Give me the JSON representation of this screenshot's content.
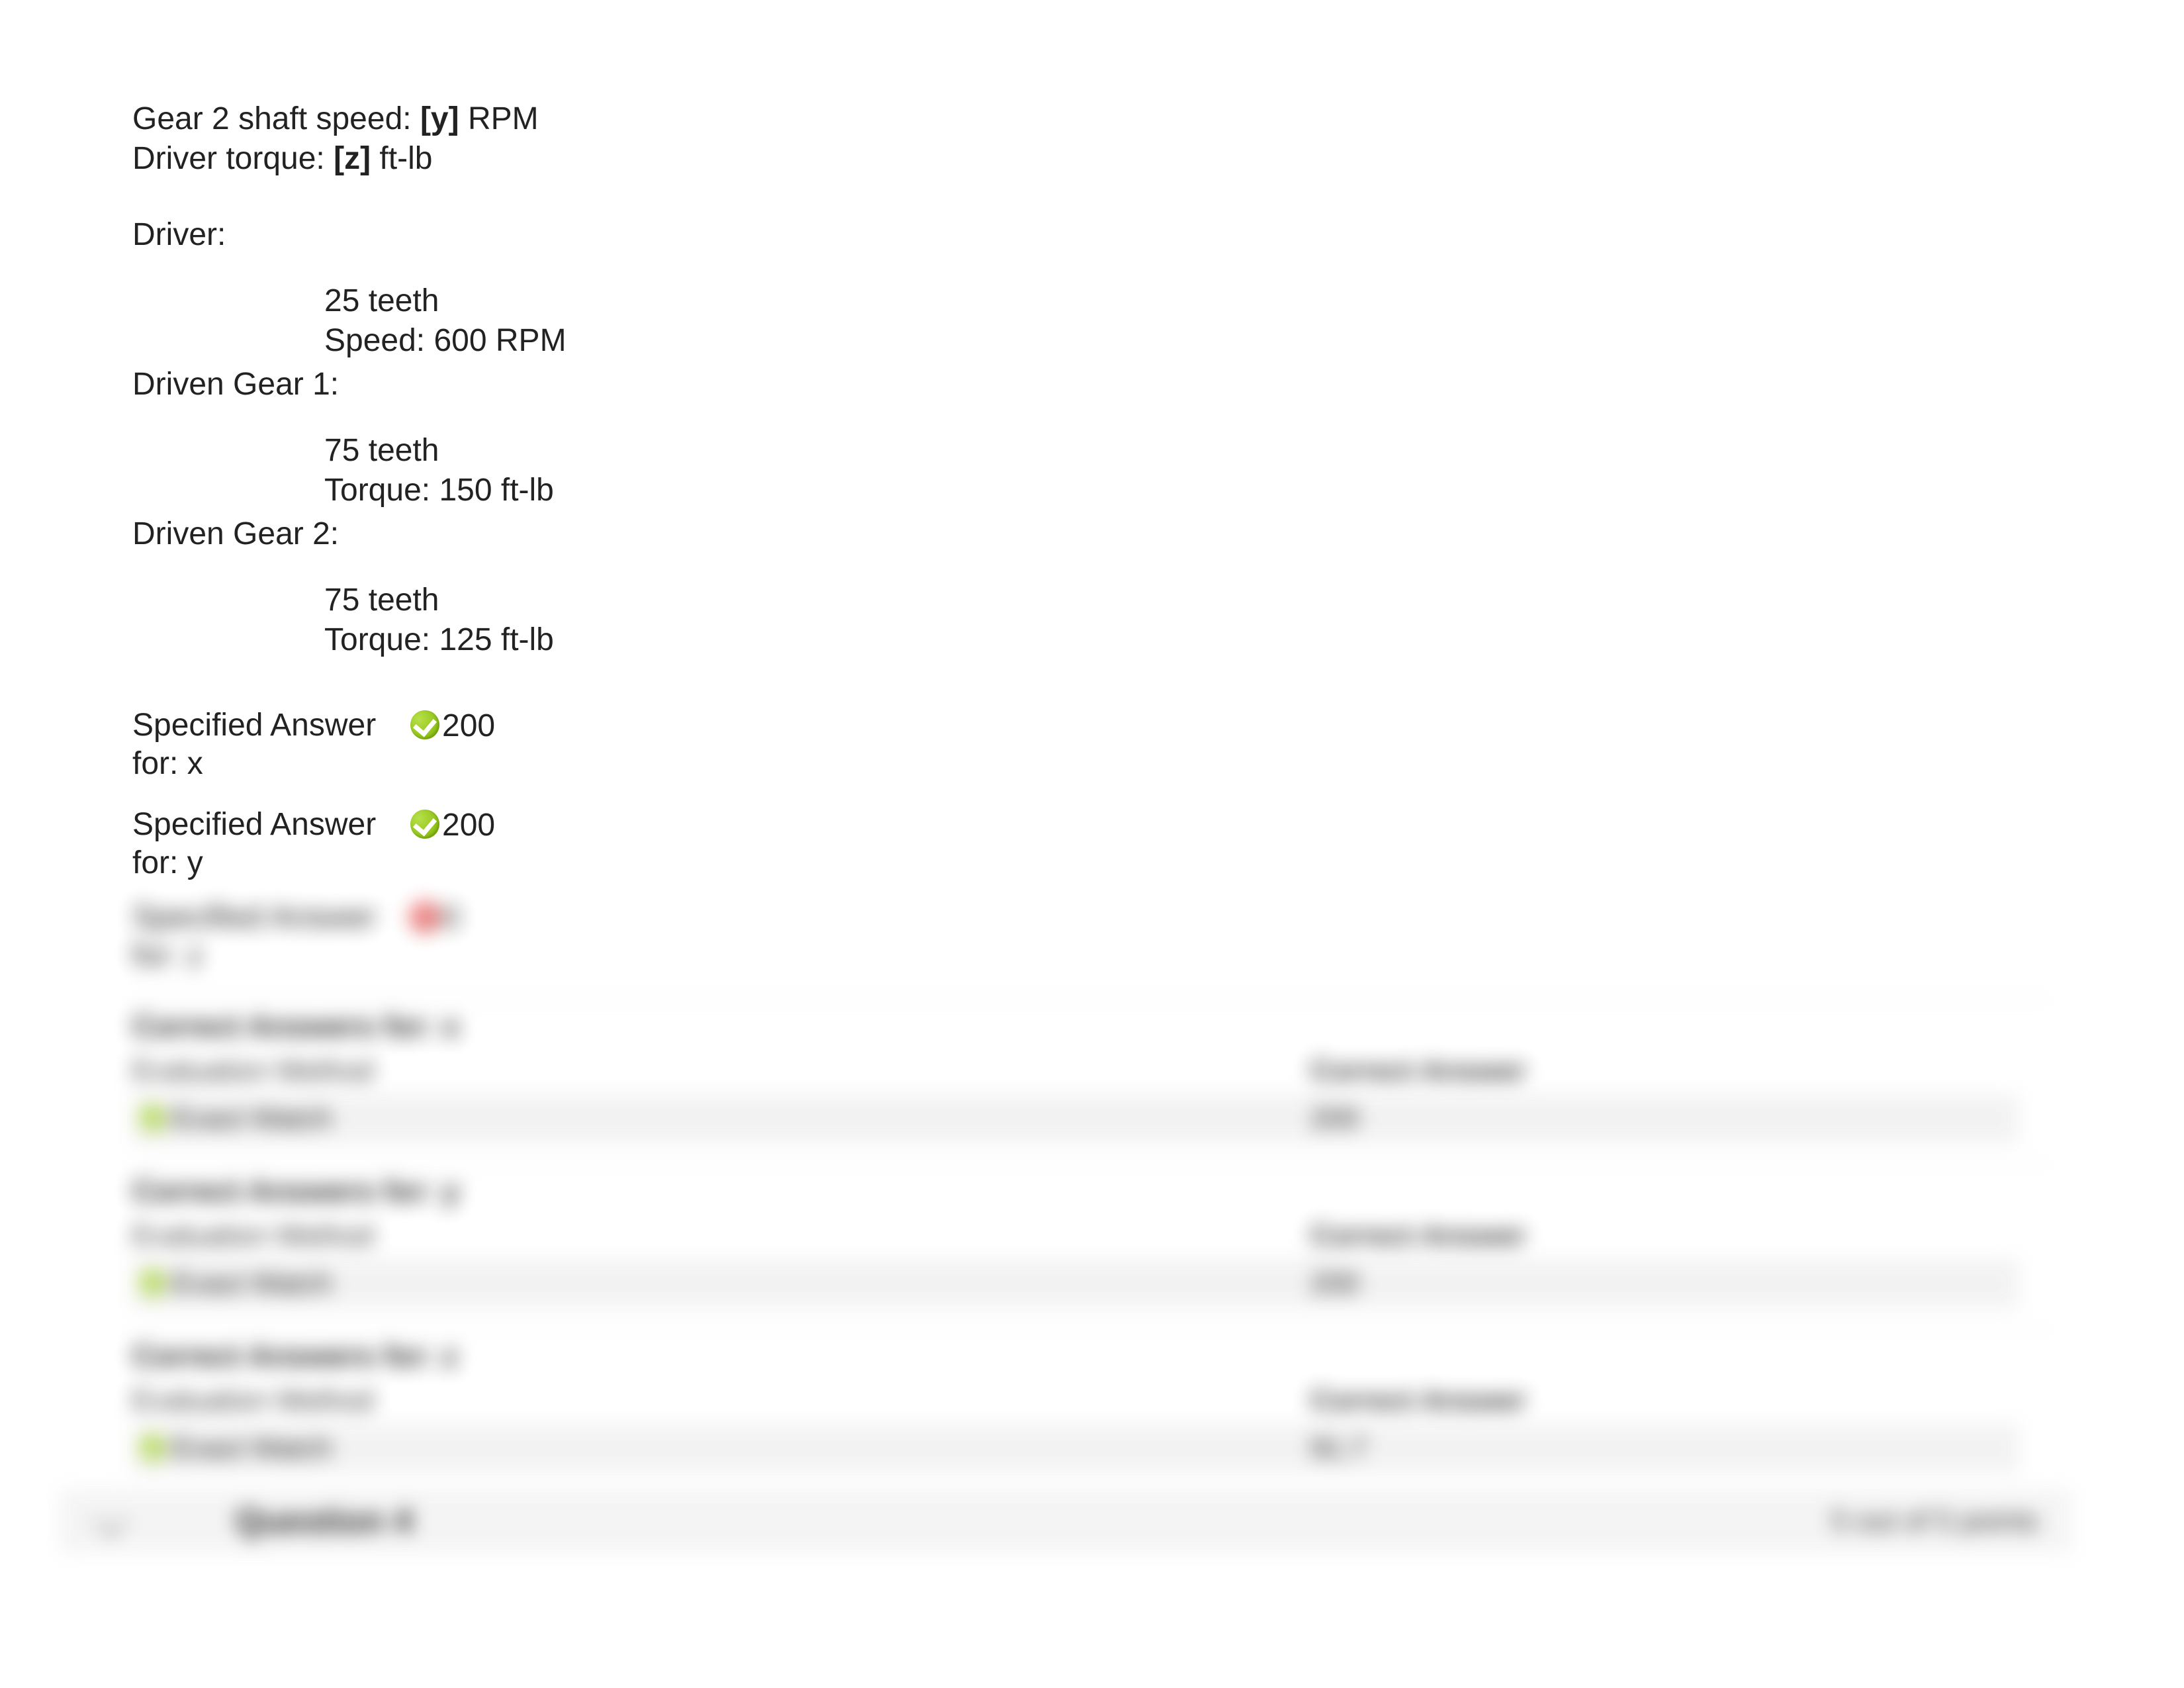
{
  "question": {
    "line1_pre": "Gear 2 shaft speed: ",
    "line1_var": "[y]",
    "line1_post": " RPM",
    "line2_pre": "Driver torque: ",
    "line2_var": "[z]",
    "line2_post": " ft-lb",
    "driver_label": "Driver:",
    "driver_teeth": "25 teeth",
    "driver_speed": "Speed: 600 RPM",
    "g1_label": "Driven Gear 1:",
    "g1_teeth": "75 teeth",
    "g1_torque": "Torque: 150 ft-lb",
    "g2_label": "Driven Gear 2:",
    "g2_teeth": "75 teeth",
    "g2_torque": "Torque: 125 ft-lb"
  },
  "specified": {
    "x_label": "Specified Answer for: x",
    "x_value": "200",
    "y_label": "Specified Answer for: y",
    "y_value": "200",
    "z_label": "Specified Answer for: z",
    "z_value": "0"
  },
  "blurred": {
    "hdr_x": "Correct Answers for: x",
    "hdr_y": "Correct Answers for: y",
    "hdr_z": "Correct Answers for: z",
    "eval_label": "Evaluation Method",
    "correct_label": "Correct Answer",
    "exact_match": "Exact Match",
    "val_x": "200",
    "val_y": "200",
    "val_z": "91.7",
    "next_q": "Question  4",
    "points": "5 out of 5 points"
  }
}
